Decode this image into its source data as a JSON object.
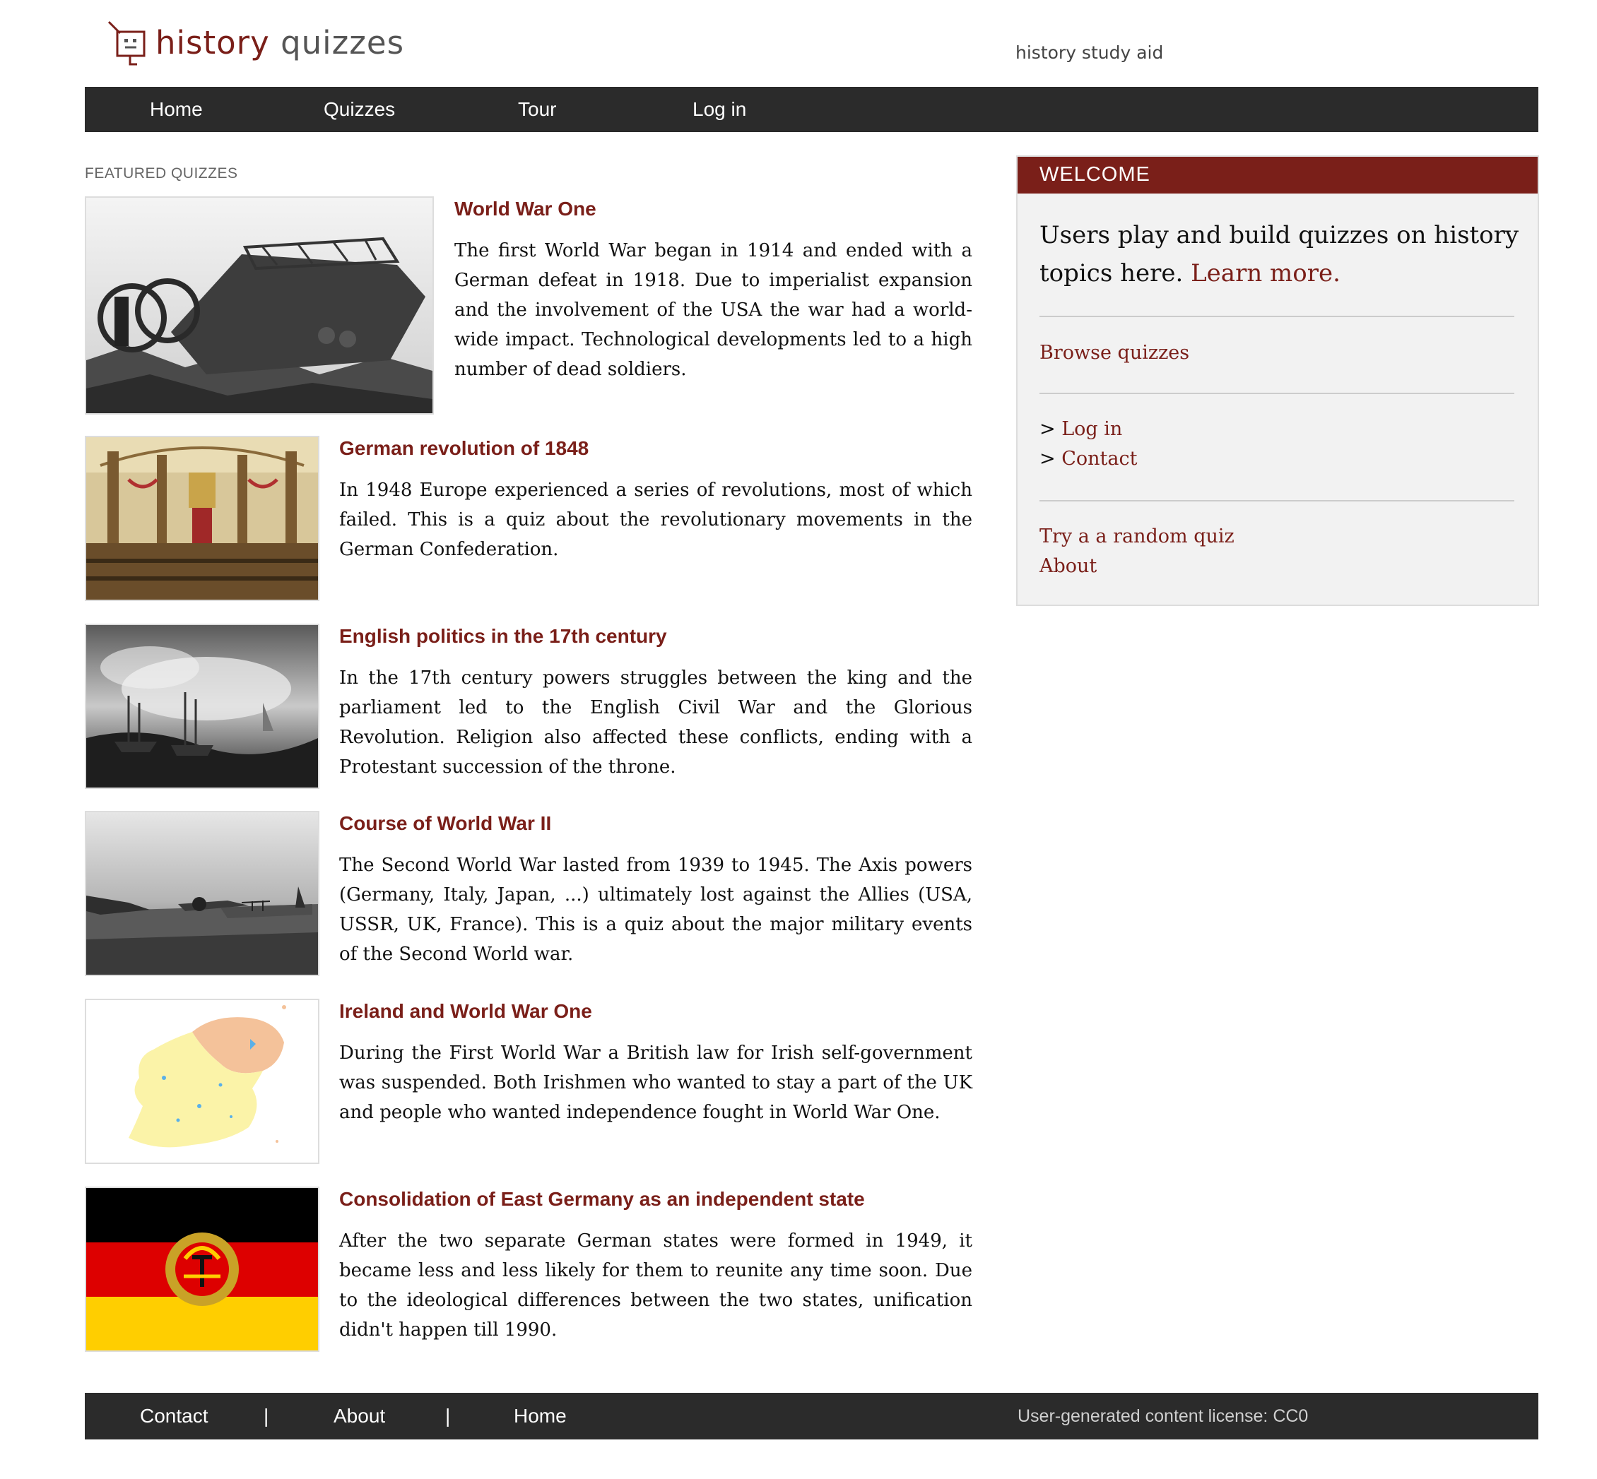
{
  "header": {
    "logo_word1": "history",
    "logo_word2": "quizzes",
    "tagline": "history study aid"
  },
  "nav": {
    "items": [
      {
        "label": "Home"
      },
      {
        "label": "Quizzes"
      },
      {
        "label": "Tour"
      },
      {
        "label": "Log in"
      }
    ]
  },
  "featured": {
    "section_label": "FEATURED QUIZZES",
    "quizzes": [
      {
        "title": "World War One",
        "description": "The first World War began in 1914 and ended with a German defeat in 1918. Due to imperialist expansion and the involvement of the USA the war had a world-wide impact. Technological developments led to a high number of dead soldiers.",
        "image_icon": "tank-photo"
      },
      {
        "title": "German revolution of 1848",
        "description": "In 1948 Europe experienced a series of revolutions, most of which failed. This is a quiz about the revolutionary movements in the German Confederation.",
        "image_icon": "assembly-hall-painting"
      },
      {
        "title": "English politics in the 17th century",
        "description": "In the 17th century powers struggles between the king and the parliament led to the English Civil War and the Glorious Revolution. Religion also affected these conflicts, ending with a Protestant succession of the throne.",
        "image_icon": "naval-battle-painting"
      },
      {
        "title": "Course of World War II",
        "description": "The Second World War lasted from 1939 to 1945. The Axis powers (Germany, Italy, Japan, ...) ultimately lost against the Allies (USA, USSR, UK, France). This is a quiz about the major military events of the Second World war.",
        "image_icon": "wrecked-aircraft-photo"
      },
      {
        "title": "Ireland and World War One",
        "description": "During the First World War a British law for Irish self-government was suspended. Both Irishmen who wanted to stay a part of the UK and people who wanted independence fought in World War One.",
        "image_icon": "ireland-map"
      },
      {
        "title": "Consolidation of East Germany as an independent state",
        "description": "After the two separate German states were formed in 1949, it became less and less likely for them to reunite any time soon. Due to the ideological differences between the two states, unification didn't happen till 1990.",
        "image_icon": "east-germany-flag"
      }
    ]
  },
  "sidebar": {
    "heading": "WELCOME",
    "intro": "Users play and build quizzes on history topics here.",
    "learn_more": "Learn more.",
    "browse": "Browse quizzes",
    "prefix": ">",
    "login": "Log in",
    "contact": "Contact",
    "random": "Try a a random quiz",
    "about": "About"
  },
  "footer": {
    "items": [
      {
        "label": "Contact"
      },
      {
        "label": "About"
      },
      {
        "label": "Home"
      }
    ],
    "separator": "|",
    "license": "User-generated content license: CC0"
  },
  "colors": {
    "accent": "#7a1f19",
    "nav_bg": "#2b2b2b",
    "sidebar_bg": "#f2f2f2"
  }
}
